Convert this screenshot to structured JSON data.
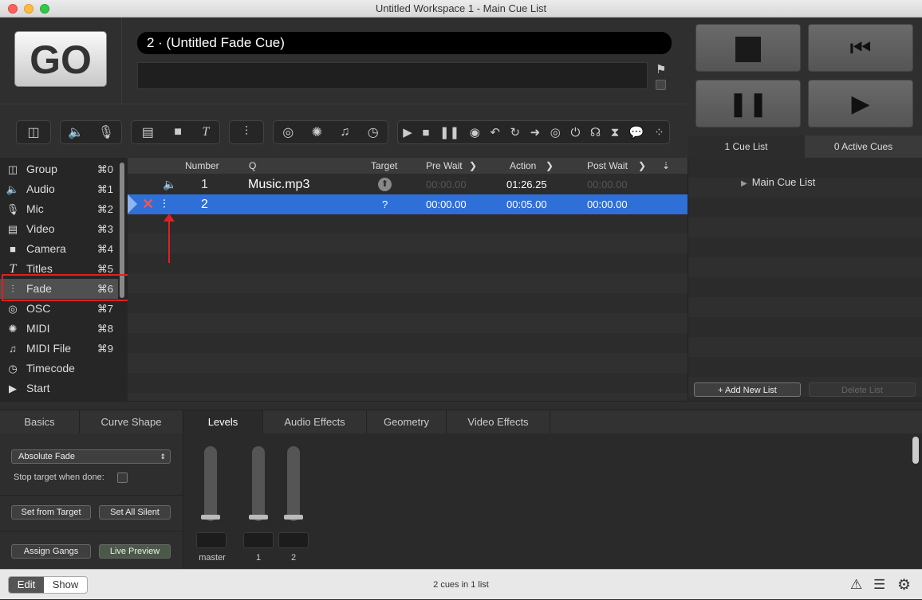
{
  "window": {
    "title": "Untitled Workspace 1 - Main Cue List"
  },
  "go_button": {
    "label": "GO"
  },
  "standby": {
    "cue_display": "2 · (Untitled Fade Cue)"
  },
  "cue_lists_tabs": {
    "cue_lists": "1 Cue List",
    "active_cues": "0 Active Cues"
  },
  "sidebar": {
    "items": [
      {
        "label": "Group",
        "shortcut": "⌘0",
        "icon": "group-icon"
      },
      {
        "label": "Audio",
        "shortcut": "⌘1",
        "icon": "speaker-icon"
      },
      {
        "label": "Mic",
        "shortcut": "⌘2",
        "icon": "mic-icon"
      },
      {
        "label": "Video",
        "shortcut": "⌘3",
        "icon": "film-icon"
      },
      {
        "label": "Camera",
        "shortcut": "⌘4",
        "icon": "camera-icon"
      },
      {
        "label": "Titles",
        "shortcut": "⌘5",
        "icon": "titles-icon"
      },
      {
        "label": "Fade",
        "shortcut": "⌘6",
        "icon": "fade-icon"
      },
      {
        "label": "OSC",
        "shortcut": "⌘7",
        "icon": "osc-icon"
      },
      {
        "label": "MIDI",
        "shortcut": "⌘8",
        "icon": "midi-icon"
      },
      {
        "label": "MIDI File",
        "shortcut": "⌘9",
        "icon": "music-note-icon"
      },
      {
        "label": "Timecode",
        "shortcut": "",
        "icon": "clock-icon"
      },
      {
        "label": "Start",
        "shortcut": "",
        "icon": "play-icon"
      }
    ]
  },
  "table": {
    "headers": {
      "number": "Number",
      "q": "Q",
      "target": "Target",
      "pre_wait": "Pre Wait",
      "action": "Action",
      "post_wait": "Post Wait"
    },
    "rows": [
      {
        "number": "1",
        "q": "Music.mp3",
        "target": "",
        "pre_wait": "00:00.00",
        "action": "01:26.25",
        "post_wait": "00:00.00",
        "selected": false
      },
      {
        "number": "2",
        "q": "",
        "target": "?",
        "pre_wait": "00:00.00",
        "action": "00:05.00",
        "post_wait": "00:00.00",
        "selected": true
      }
    ]
  },
  "cue_lists": {
    "items": [
      "Main Cue List"
    ],
    "add_label": "+ Add New List",
    "delete_label": "Delete List"
  },
  "inspector": {
    "tabs": [
      "Basics",
      "Curve Shape",
      "Levels",
      "Audio Effects",
      "Geometry",
      "Video Effects"
    ],
    "active_tab": "Levels",
    "fade_mode": "Absolute Fade",
    "stop_target_label": "Stop target when done:",
    "set_from_target": "Set from Target",
    "set_all_silent": "Set All Silent",
    "assign_gangs": "Assign Gangs",
    "live_preview": "Live Preview",
    "faders": [
      "master",
      "1",
      "2"
    ]
  },
  "status": {
    "edit": "Edit",
    "show": "Show",
    "summary": "2 cues in 1 list"
  },
  "colors": {
    "selection": "#2f6fd8",
    "annotation": "#e02020",
    "accent_blue": "#5a9be8"
  }
}
